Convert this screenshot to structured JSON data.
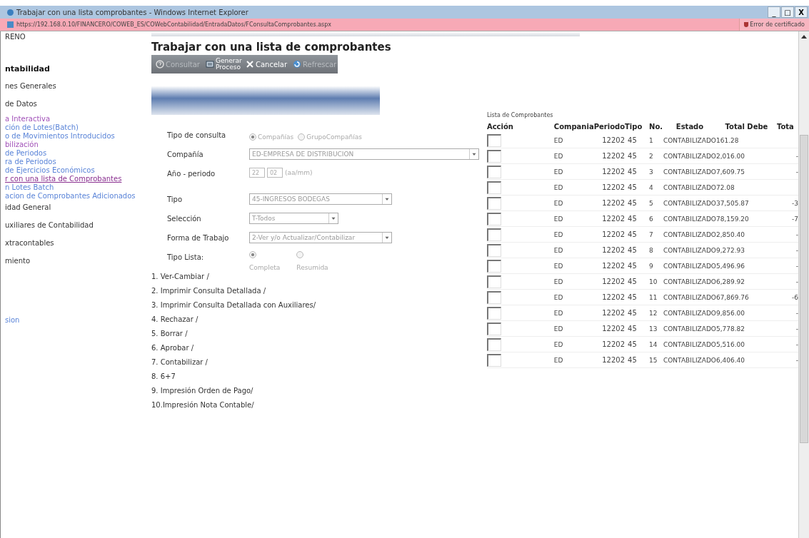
{
  "window": {
    "title": "Trabajar con una lista comprobantes - Windows Internet Explorer",
    "controls": [
      "_",
      "□",
      "X"
    ]
  },
  "address_bar": {
    "url": "https://192.168.0.10/FINANCERO/COWEB_ES/COWebContabilidad/EntradaDatos/FConsultaComprobantes.aspx",
    "certificate_error": "Error de certificado"
  },
  "sidebar": {
    "items": [
      {
        "label": "RENO",
        "kind": "plain",
        "selected": false
      },
      {
        "label": "ntabilidad",
        "kind": "heading",
        "selected": false
      },
      {
        "label": "nes Generales",
        "kind": "plain",
        "selected": false
      },
      {
        "label": "de Datos",
        "kind": "plain",
        "selected": false
      },
      {
        "label": "a Interactiva",
        "kind": "visited",
        "selected": false
      },
      {
        "label": "ción de Lotes(Batch)",
        "kind": "link",
        "selected": false
      },
      {
        "label": "o de Movimientos Introducidos",
        "kind": "link",
        "selected": false
      },
      {
        "label": "bilización",
        "kind": "visited",
        "selected": false
      },
      {
        "label": "de Periodos",
        "kind": "link",
        "selected": false
      },
      {
        "label": "ra de Periodos",
        "kind": "link",
        "selected": false
      },
      {
        "label": "de Ejercicios Económicos",
        "kind": "link",
        "selected": false
      },
      {
        "label": "r con una lista de Comprobantes",
        "kind": "visited",
        "selected": true
      },
      {
        "label": "n Lotes Batch",
        "kind": "link",
        "selected": false
      },
      {
        "label": "acion de Comprobantes Adicionados",
        "kind": "link",
        "selected": false
      },
      {
        "label": "idad General",
        "kind": "plain",
        "selected": false
      },
      {
        "label": "uxiliares de Contabilidad",
        "kind": "plain",
        "selected": false
      },
      {
        "label": "xtracontables",
        "kind": "plain",
        "selected": false
      },
      {
        "label": "miento",
        "kind": "plain",
        "selected": false
      },
      {
        "label": "sion",
        "kind": "link",
        "selected": false
      }
    ]
  },
  "page_title": "Trabajar con una lista de comprobantes",
  "toolbar": [
    {
      "label": "Consultar",
      "kind": "query",
      "disabled": true
    },
    {
      "label": "Generar Proceso",
      "kind": "process",
      "disabled": false
    },
    {
      "label": "Cancelar",
      "kind": "cancel",
      "disabled": false
    },
    {
      "label": "Refrescar",
      "kind": "refresh",
      "disabled": true
    }
  ],
  "form": {
    "tipo_consulta": {
      "label": "Tipo de consulta",
      "options": [
        {
          "label": "Compañías",
          "selected": true
        },
        {
          "label": "GrupoCompañías",
          "selected": false
        }
      ]
    },
    "compania": {
      "label": "Compañía",
      "value": "ED-EMPRESA DE DISTRIBUCION"
    },
    "anio_periodo": {
      "label": "Año - periodo",
      "year": "22",
      "month": "02",
      "hint": "(aa/mm)"
    },
    "tipo": {
      "label": "Tipo",
      "value": "45-INGRESOS BODEGAS"
    },
    "seleccion": {
      "label": "Selección",
      "value": "T-Todos"
    },
    "forma_trabajo": {
      "label": "Forma de Trabajo",
      "value": "2-Ver y/o Actualizar/Contabilizar"
    },
    "tipo_lista": {
      "label": "Tipo Lista:",
      "options": [
        {
          "label": "Completa",
          "selected": true
        },
        {
          "label": "Resumida",
          "selected": false
        }
      ]
    }
  },
  "actions": [
    "1. Ver-Cambiar /",
    "2. Imprimir Consulta Detallada /",
    "3. Imprimir Consulta Detallada con Auxiliares/",
    "4. Rechazar /",
    "5. Borrar /",
    "6. Aprobar /",
    "7. Contabilizar /",
    "8. 6+7",
    "9. Impresión Orden de Pago/",
    "10.Impresión Nota Contable/"
  ],
  "table": {
    "caption": "Lista de Comprobantes",
    "columns": [
      "Acción",
      "Compania",
      "Periodo",
      "Tipo",
      "No.",
      "Estado",
      "Total Debe",
      "Tota"
    ],
    "rows": [
      {
        "checked": false,
        "compania": "ED",
        "periodo": "12202",
        "tipo": "45",
        "no": "1",
        "estado": "CONTABILIZADO",
        "total_debe": "161.28"
      },
      {
        "checked": false,
        "compania": "ED",
        "periodo": "12202",
        "tipo": "45",
        "no": "2",
        "estado": "CONTABILIZADO",
        "total_debe": "2,016.00",
        "column_8": "-"
      },
      {
        "checked": false,
        "compania": "ED",
        "periodo": "12202",
        "tipo": "45",
        "no": "3",
        "estado": "CONTABILIZADO",
        "total_debe": "7,609.75",
        "column_8": "-"
      },
      {
        "checked": false,
        "compania": "ED",
        "periodo": "12202",
        "tipo": "45",
        "no": "4",
        "estado": "CONTABILIZADO",
        "total_debe": "72.08"
      },
      {
        "checked": false,
        "compania": "ED",
        "periodo": "12202",
        "tipo": "45",
        "no": "5",
        "estado": "CONTABILIZADO",
        "total_debe": "37,505.87",
        "column_8": "-3"
      },
      {
        "checked": false,
        "compania": "ED",
        "periodo": "12202",
        "tipo": "45",
        "no": "6",
        "estado": "CONTABILIZADO",
        "total_debe": "78,159.20",
        "column_8": "-7"
      },
      {
        "checked": false,
        "compania": "ED",
        "periodo": "12202",
        "tipo": "45",
        "no": "7",
        "estado": "CONTABILIZADO",
        "total_debe": "2,850.40",
        "column_8": "-"
      },
      {
        "checked": false,
        "compania": "ED",
        "periodo": "12202",
        "tipo": "45",
        "no": "8",
        "estado": "CONTABILIZADO",
        "total_debe": "9,272.93",
        "column_8": "-"
      },
      {
        "checked": false,
        "compania": "ED",
        "periodo": "12202",
        "tipo": "45",
        "no": "9",
        "estado": "CONTABILIZADO",
        "total_debe": "5,496.96",
        "column_8": "-"
      },
      {
        "checked": false,
        "compania": "ED",
        "periodo": "12202",
        "tipo": "45",
        "no": "10",
        "estado": "CONTABILIZADO",
        "total_debe": "6,289.92",
        "column_8": "-"
      },
      {
        "checked": false,
        "compania": "ED",
        "periodo": "12202",
        "tipo": "45",
        "no": "11",
        "estado": "CONTABILIZADO",
        "total_debe": "67,869.76",
        "column_8": "-6"
      },
      {
        "checked": false,
        "compania": "ED",
        "periodo": "12202",
        "tipo": "45",
        "no": "12",
        "estado": "CONTABILIZADO",
        "total_debe": "9,856.00",
        "column_8": "-"
      },
      {
        "checked": false,
        "compania": "ED",
        "periodo": "12202",
        "tipo": "45",
        "no": "13",
        "estado": "CONTABILIZADO",
        "total_debe": "5,778.82",
        "column_8": "-"
      },
      {
        "checked": false,
        "compania": "ED",
        "periodo": "12202",
        "tipo": "45",
        "no": "14",
        "estado": "CONTABILIZADO",
        "total_debe": "5,516.00",
        "column_8": "-"
      },
      {
        "checked": false,
        "compania": "ED",
        "periodo": "12202",
        "tipo": "45",
        "no": "15",
        "estado": "CONTABILIZADO",
        "total_debe": "6,406.40",
        "column_8": "-"
      }
    ]
  }
}
